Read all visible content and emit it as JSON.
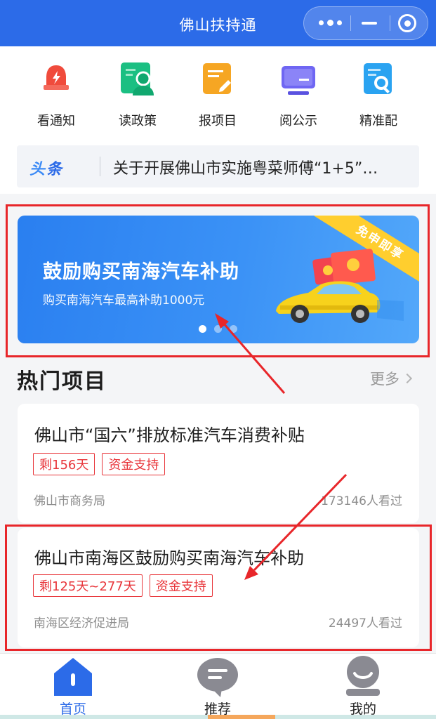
{
  "titlebar": {
    "title": "佛山扶持通",
    "capsule": [
      "more-icon",
      "minimize-icon",
      "close-target-icon"
    ]
  },
  "quick_entries": [
    {
      "label": "看通知",
      "icon": "bell-icon",
      "color": "#f04b3c"
    },
    {
      "label": "读政策",
      "icon": "person-search-icon",
      "color": "#1bbf82"
    },
    {
      "label": "报项目",
      "icon": "edit-doc-icon",
      "color": "#f6a623"
    },
    {
      "label": "阅公示",
      "icon": "monitor-icon",
      "color": "#6f66f3"
    },
    {
      "label": "精准配",
      "icon": "doc-search-icon",
      "color": "#2aa3f1"
    }
  ],
  "headline": {
    "tag_a": "头",
    "tag_b": "条",
    "text": "关于开展佛山市实施粤菜师傅“1+5”…"
  },
  "banner": {
    "title": "鼓励购买南海汽车补助",
    "subtitle": "购买南海汽车最高补助1000元",
    "ribbon": "免申即享",
    "page_count": 3,
    "active_page": 1
  },
  "hot_section": {
    "title": "热门项目",
    "more_label": "更多"
  },
  "projects": [
    {
      "title": "佛山市“国六”排放标准汽车消费补贴",
      "tags": [
        "剩156天",
        "资金支持"
      ],
      "org": "佛山市商务局",
      "views": "173146人看过"
    },
    {
      "title": "佛山市南海区鼓励购买南海汽车补助",
      "tags": [
        "剩125天~277天",
        "资金支持"
      ],
      "org": "南海区经济促进局",
      "views": "24497人看过"
    }
  ],
  "tabbar": [
    {
      "label": "首页",
      "icon": "home-icon",
      "active": true
    },
    {
      "label": "推荐",
      "icon": "chat-bubble-icon",
      "active": false
    },
    {
      "label": "我的",
      "icon": "user-icon",
      "active": false
    }
  ],
  "colors": {
    "primary": "#2c6be8",
    "highlight_red": "#e8262a",
    "tag_red": "#e8353a",
    "ribbon_yellow": "#ffce2e"
  }
}
